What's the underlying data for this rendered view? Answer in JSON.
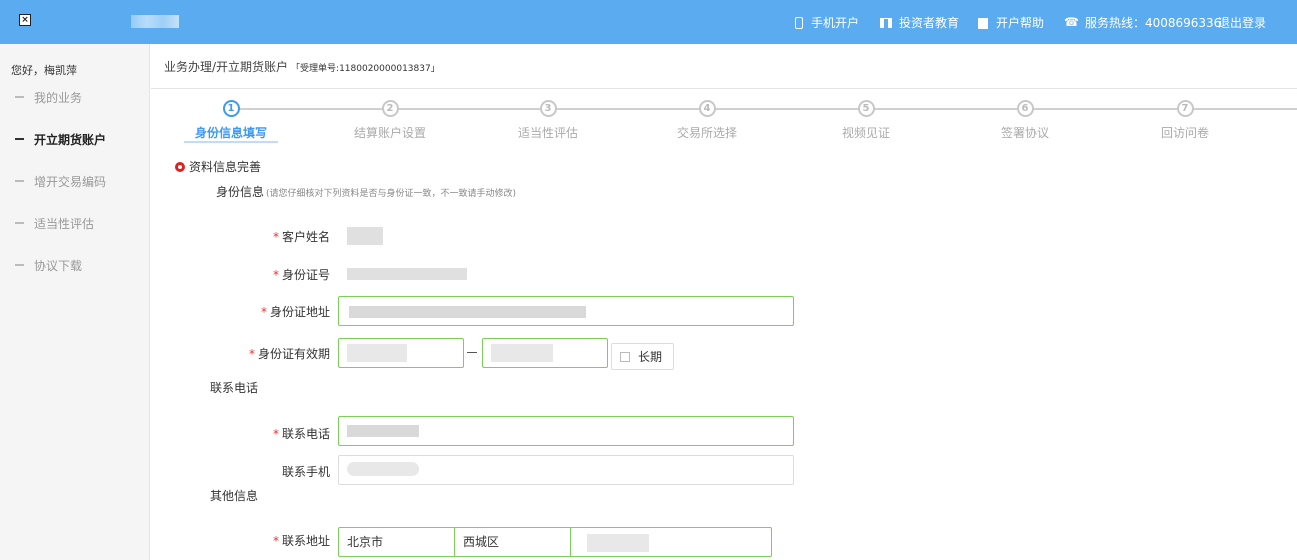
{
  "topbar": {
    "nav": {
      "mobile": "手机开户",
      "investor_edu": "投资者教育",
      "help": "开户帮助",
      "hotline": "服务热线：4008696336",
      "logout": "退出登录"
    }
  },
  "sidebar": {
    "greeting": "您好，梅凯萍",
    "items": [
      {
        "label": "我的业务",
        "active": false
      },
      {
        "label": "开立期货账户",
        "active": true
      },
      {
        "label": "增开交易编码",
        "active": false
      },
      {
        "label": "适当性评估",
        "active": false
      },
      {
        "label": "协议下载",
        "active": false
      }
    ]
  },
  "breadcrumb": {
    "path": "业务办理/开立期货账户",
    "acceptance": "「受理单号:1180020000013837」"
  },
  "steps": [
    {
      "num": "1",
      "label": "身份信息填写",
      "active": true
    },
    {
      "num": "2",
      "label": "结算账户设置",
      "active": false
    },
    {
      "num": "3",
      "label": "适当性评估",
      "active": false
    },
    {
      "num": "4",
      "label": "交易所选择",
      "active": false
    },
    {
      "num": "5",
      "label": "视频见证",
      "active": false
    },
    {
      "num": "6",
      "label": "签署协议",
      "active": false
    },
    {
      "num": "7",
      "label": "回访问卷",
      "active": false
    }
  ],
  "form": {
    "section_title": "资料信息完善",
    "identity_heading": "身份信息",
    "identity_hint": "(请您仔细核对下列资料是否与身份证一致，不一致请手动修改)",
    "labels": {
      "name": "客户姓名",
      "id_number": "身份证号",
      "id_address": "身份证地址",
      "id_validity": "身份证有效期",
      "phone": "联系电话",
      "mobile": "联系手机",
      "address": "联系地址"
    },
    "required_mark": "*",
    "long_term_label": "长期",
    "contact_group": "联系电话",
    "other_group": "其他信息",
    "address": {
      "province": "北京市",
      "district": "西城区"
    }
  },
  "colors": {
    "topbar": "#5aabf0",
    "active_step": "#3d9af0",
    "field_border": "#7ccf58",
    "required": "#e33333"
  }
}
